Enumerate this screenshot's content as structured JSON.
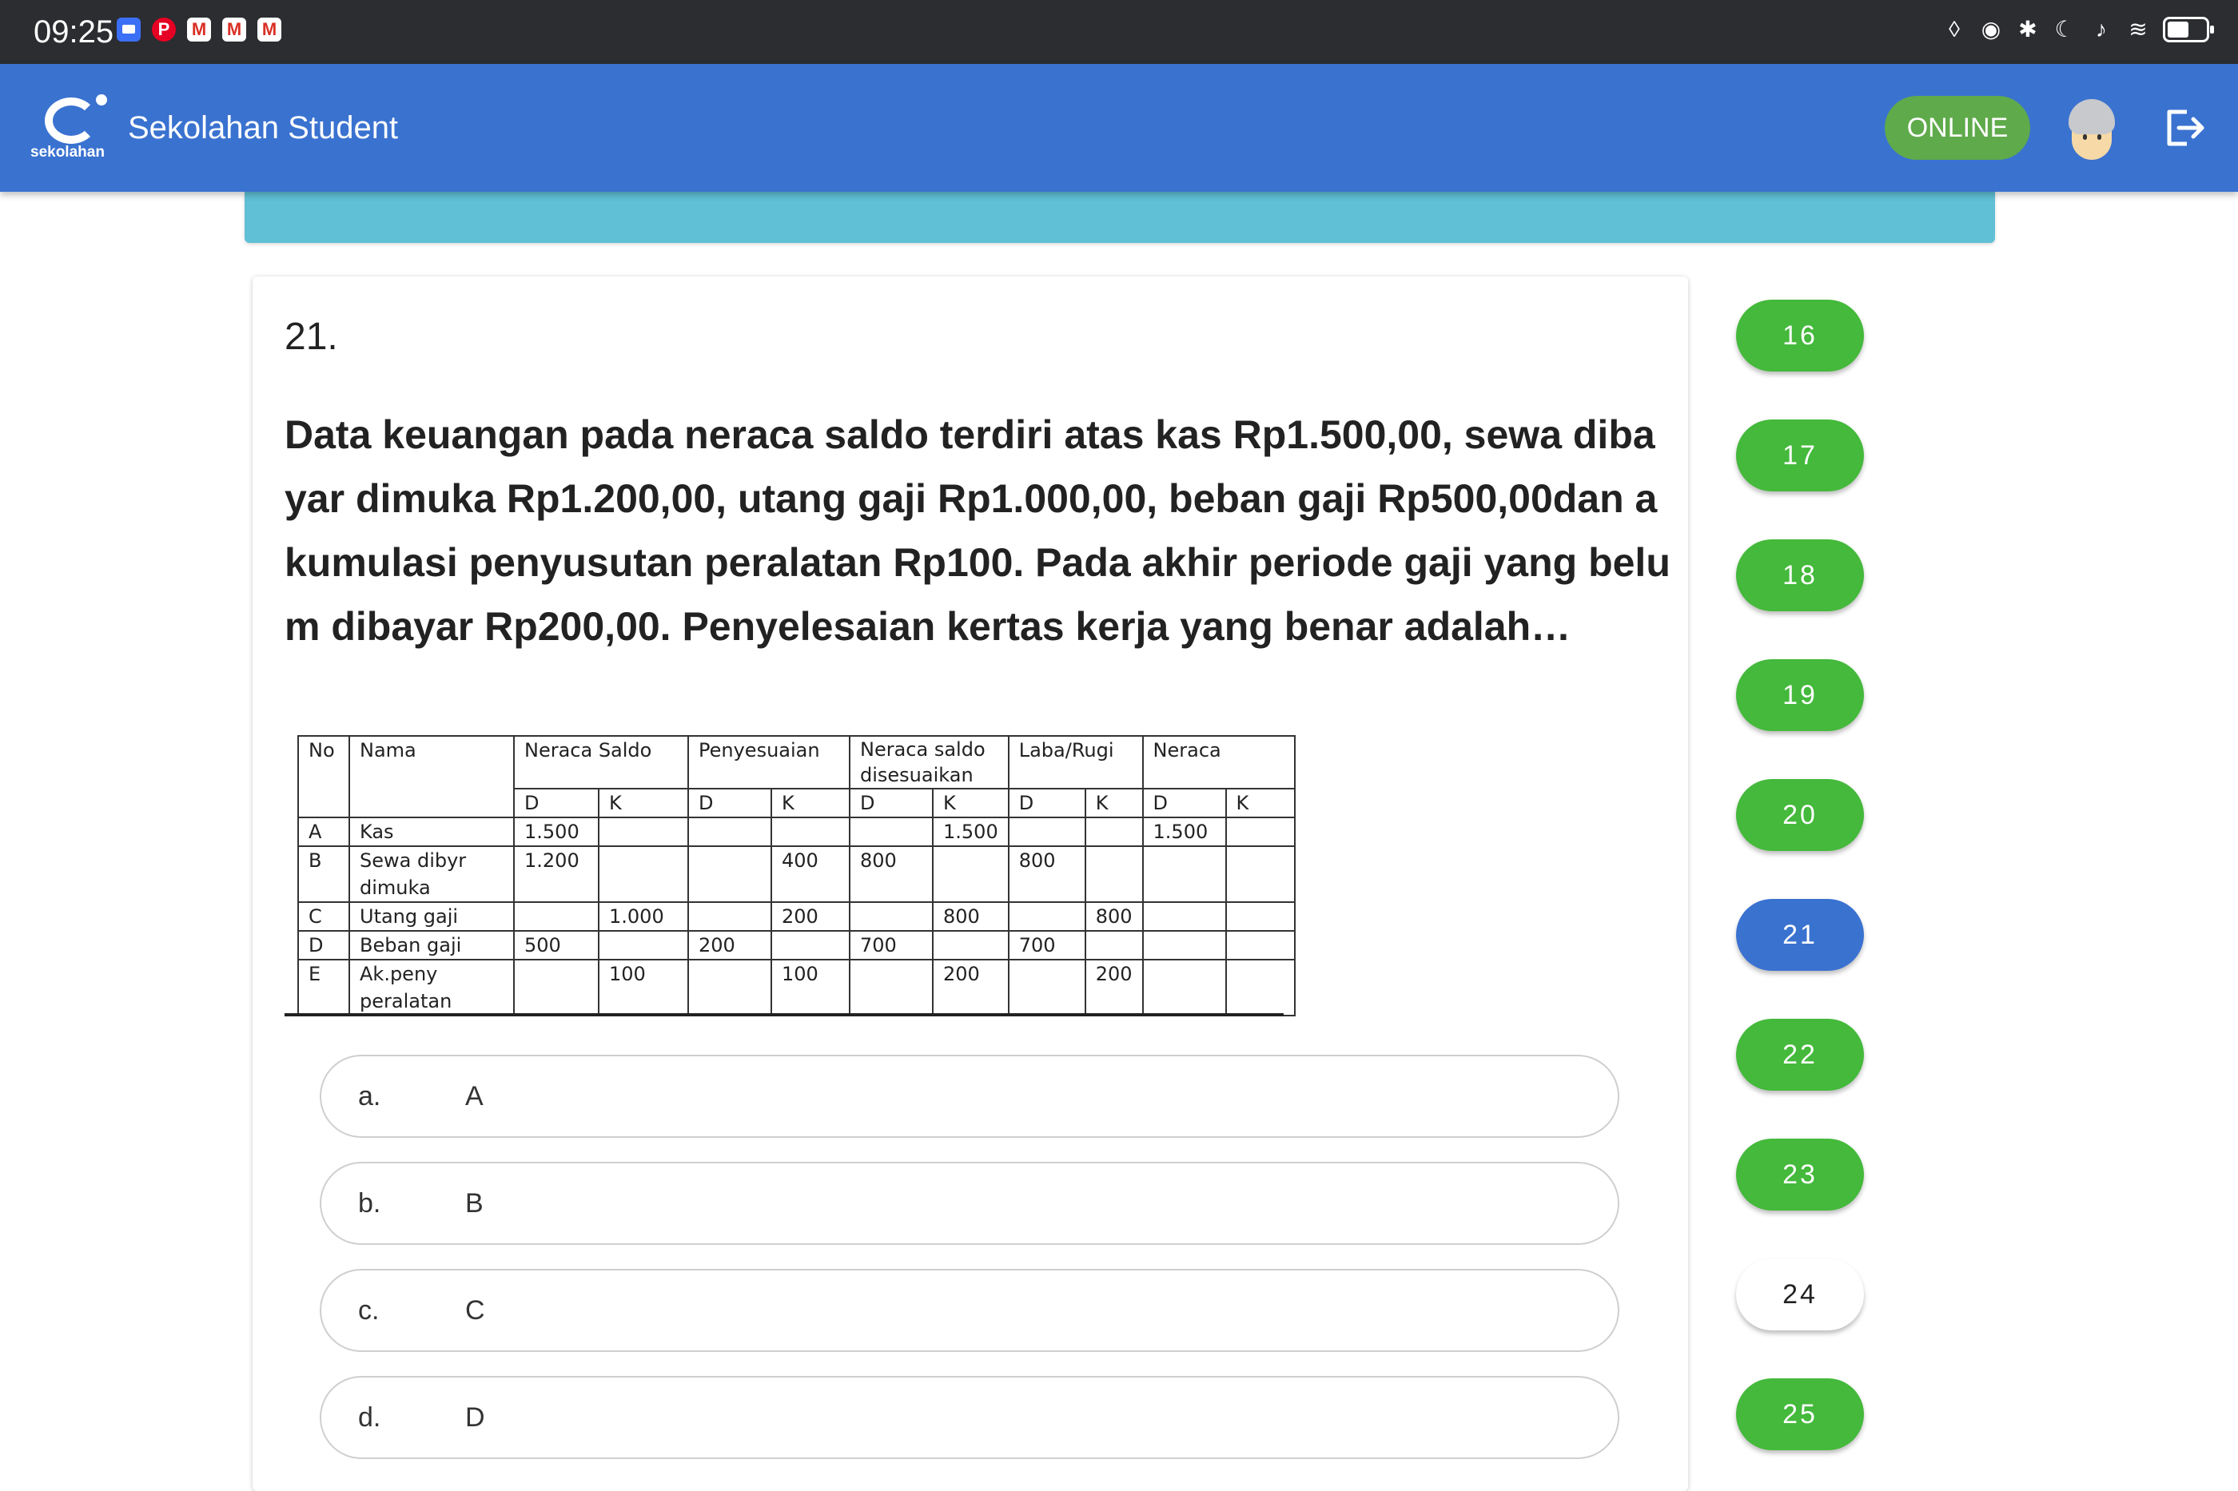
{
  "status_bar": {
    "time": "09:25",
    "left_icons": [
      "message-icon",
      "pinterest-icon",
      "gmail-icon",
      "gmail-icon",
      "gmail-icon"
    ],
    "right_icons": [
      "nfc-icon",
      "eye-icon",
      "bluetooth-icon",
      "moon-icon",
      "bell-off-icon",
      "wifi-icon",
      "battery-icon"
    ]
  },
  "app_bar": {
    "logo_text": "sekolahan",
    "title": "Sekolahan Student",
    "status_badge": "ONLINE",
    "colors": {
      "bar": "#3a72d0",
      "badge": "#5faa4b"
    }
  },
  "question": {
    "number": "21.",
    "text": "Data keuangan pada neraca saldo terdiri atas kas Rp1.500,00, sewa dibayar dimuka Rp1.200,00, utang gaji Rp1.000,00, beban gaji Rp500,00dan akumulasi penyusutan peralatan Rp100. Pada akhir periode gaji yang belum dibayar Rp200,00. Penyelesaian kertas kerja yang benar adalah…",
    "table": {
      "headers": [
        "No",
        "Nama",
        "Neraca Saldo",
        "Penyesuaian",
        "Neraca saldo disesuaikan",
        "Laba/Rugi",
        "Neraca"
      ],
      "sub": [
        "D",
        "K",
        "D",
        "K",
        "D",
        "K",
        "D",
        "K",
        "D",
        "K"
      ],
      "rows": [
        [
          "A",
          "Kas",
          "1.500",
          "",
          "",
          "",
          "",
          "1.500",
          "",
          "",
          "1.500",
          ""
        ],
        [
          "B",
          "Sewa dibyr dimuka",
          "1.200",
          "",
          "",
          "400",
          "800",
          "",
          "800",
          "",
          "",
          ""
        ],
        [
          "C",
          "Utang gaji",
          "",
          "1.000",
          "",
          "200",
          "",
          "800",
          "",
          "800",
          "",
          ""
        ],
        [
          "D",
          "Beban gaji",
          "500",
          "",
          "200",
          "",
          "700",
          "",
          "700",
          "",
          "",
          ""
        ],
        [
          "E",
          "Ak.peny peralatan",
          "",
          "100",
          "",
          "100",
          "",
          "200",
          "",
          "200",
          "",
          ""
        ]
      ]
    },
    "options": [
      {
        "letter": "a.",
        "text": "A"
      },
      {
        "letter": "b.",
        "text": "B"
      },
      {
        "letter": "c.",
        "text": "C"
      },
      {
        "letter": "d.",
        "text": "D"
      }
    ]
  },
  "navigator": {
    "pills": [
      {
        "label": "16",
        "state": "answered"
      },
      {
        "label": "17",
        "state": "answered"
      },
      {
        "label": "18",
        "state": "answered"
      },
      {
        "label": "19",
        "state": "answered"
      },
      {
        "label": "20",
        "state": "answered"
      },
      {
        "label": "21",
        "state": "current"
      },
      {
        "label": "22",
        "state": "answered"
      },
      {
        "label": "23",
        "state": "answered"
      },
      {
        "label": "24",
        "state": "unanswered"
      },
      {
        "label": "25",
        "state": "answered"
      }
    ],
    "colors": {
      "answered": "#44b93b",
      "current": "#3a72d0",
      "unanswered": "#ffffff"
    }
  }
}
